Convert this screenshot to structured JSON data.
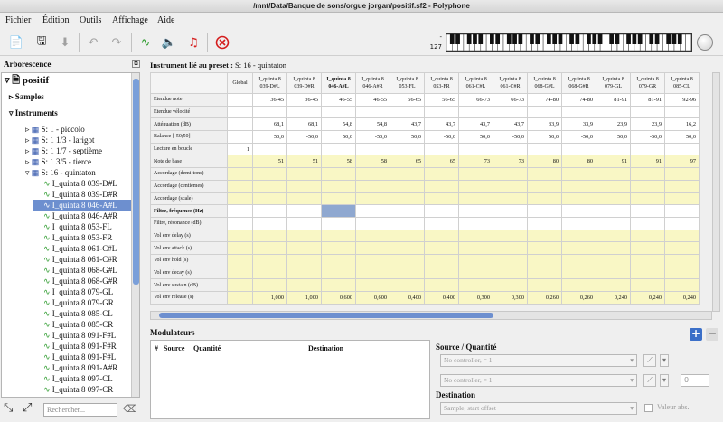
{
  "window": {
    "title": "/mnt/Data/Banque de sons/orgue jorgan/positif.sf2 - Polyphone"
  },
  "menu": [
    "Fichier",
    "Édition",
    "Outils",
    "Affichage",
    "Aide"
  ],
  "toolbar": {
    "volume_top": "-",
    "volume_bottom": "127"
  },
  "left": {
    "title": "Arborescence",
    "root": "positif",
    "samples": "Samples",
    "instruments": "Instruments",
    "items": [
      "S: 1 - piccolo",
      "S: 1 1/3 - larigot",
      "S: 1 1/7 - septième",
      "S: 1 3/5 - tierce",
      "S: 16 - quintaton"
    ],
    "children": [
      "I_quinta 8 039-D#L",
      "I_quinta 8 039-D#R",
      "I_quinta 8 046-A#L",
      "I_quinta 8 046-A#R",
      "I_quinta 8 053-FL",
      "I_quinta 8 053-FR",
      "I_quinta 8 061-C#L",
      "I_quinta 8 061-C#R",
      "I_quinta 8 068-G#L",
      "I_quinta 8 068-G#R",
      "I_quinta 8 079-GL",
      "I_quinta 8 079-GR",
      "I_quinta 8 085-CL",
      "I_quinta 8 085-CR",
      "I_quinta 8 091-F#L",
      "I_quinta 8 091-F#R",
      "I_quinta 8 091-F#L",
      "I_quinta 8 091-A#R",
      "I_quinta 8 097-CL",
      "I_quinta 8 097-CR",
      "I_quinta 8 097-CR"
    ],
    "search_placeholder": "Rechercher..."
  },
  "editor": {
    "title_label": "Instrument lié au preset :",
    "title_value": "S: 16 - quintaton",
    "columns": [
      "Global",
      "I_quinta 8\n039-D#L",
      "I_quinta 8\n039-D#R",
      "I_quinta 8\n046-A#L",
      "I_quinta 8\n046-A#R",
      "I_quinta 8\n053-FL",
      "I_quinta 8\n053-FR",
      "I_quinta 8\n061-C#L",
      "I_quinta 8\n061-C#R",
      "I_quinta 8\n068-G#L",
      "I_quinta 8\n068-G#R",
      "I_quinta 8\n079-GL",
      "I_quinta 8\n079-GR",
      "I_quinta 8\n085-CL"
    ],
    "rows": [
      {
        "label": "Etendue note",
        "values": [
          "",
          "36-45",
          "36-45",
          "46-55",
          "46-55",
          "56-65",
          "56-65",
          "66-73",
          "66-73",
          "74-80",
          "74-80",
          "81-91",
          "81-91",
          "92-96"
        ]
      },
      {
        "label": "Etendue vélocité",
        "values": [
          "",
          "",
          "",
          "",
          "",
          "",
          "",
          "",
          "",
          "",
          "",
          "",
          "",
          ""
        ]
      },
      {
        "label": "Atténuation (dB)",
        "values": [
          "",
          "68,1",
          "68,1",
          "54,8",
          "54,8",
          "43,7",
          "43,7",
          "43,7",
          "43,7",
          "33,9",
          "33,9",
          "23,9",
          "23,9",
          "16,2"
        ]
      },
      {
        "label": "Balance [-50;50]",
        "values": [
          "",
          "50,0",
          "-50,0",
          "50,0",
          "-50,0",
          "50,0",
          "-50,0",
          "50,0",
          "-50,0",
          "50,0",
          "-50,0",
          "50,0",
          "-50,0",
          "50,0"
        ]
      },
      {
        "label": "Lecture en boucle",
        "values": [
          "1",
          "",
          "",
          "",
          "",
          "",
          "",
          "",
          "",
          "",
          "",
          "",
          "",
          ""
        ]
      },
      {
        "label": "Note de base",
        "values": [
          "",
          "51",
          "51",
          "58",
          "58",
          "65",
          "65",
          "73",
          "73",
          "80",
          "80",
          "91",
          "91",
          "97"
        ]
      },
      {
        "label": "Accordage (demi-tons)",
        "values": [
          "",
          "",
          "",
          "",
          "",
          "",
          "",
          "",
          "",
          "",
          "",
          "",
          "",
          ""
        ]
      },
      {
        "label": "Accordage (centièmes)",
        "values": [
          "",
          "",
          "",
          "",
          "",
          "",
          "",
          "",
          "",
          "",
          "",
          "",
          "",
          ""
        ]
      },
      {
        "label": "Accordage (scale)",
        "values": [
          "",
          "",
          "",
          "",
          "",
          "",
          "",
          "",
          "",
          "",
          "",
          "",
          "",
          ""
        ]
      },
      {
        "label": "Filtre, fréquence (Hz)",
        "values": [
          "",
          "",
          "",
          "",
          "",
          "",
          "",
          "",
          "",
          "",
          "",
          "",
          "",
          ""
        ]
      },
      {
        "label": "Filtre, résonance (dB)",
        "values": [
          "",
          "",
          "",
          "",
          "",
          "",
          "",
          "",
          "",
          "",
          "",
          "",
          "",
          ""
        ]
      },
      {
        "label": "Vol env delay (s)",
        "values": [
          "",
          "",
          "",
          "",
          "",
          "",
          "",
          "",
          "",
          "",
          "",
          "",
          "",
          ""
        ]
      },
      {
        "label": "Vol env attack (s)",
        "values": [
          "",
          "",
          "",
          "",
          "",
          "",
          "",
          "",
          "",
          "",
          "",
          "",
          "",
          ""
        ]
      },
      {
        "label": "Vol env hold (s)",
        "values": [
          "",
          "",
          "",
          "",
          "",
          "",
          "",
          "",
          "",
          "",
          "",
          "",
          "",
          ""
        ]
      },
      {
        "label": "Vol env decay (s)",
        "values": [
          "",
          "",
          "",
          "",
          "",
          "",
          "",
          "",
          "",
          "",
          "",
          "",
          "",
          ""
        ]
      },
      {
        "label": "Vol env sustain (dB)",
        "values": [
          "",
          "",
          "",
          "",
          "",
          "",
          "",
          "",
          "",
          "",
          "",
          "",
          "",
          ""
        ]
      },
      {
        "label": "Vol env release (s)",
        "values": [
          "",
          "1,000",
          "1,000",
          "0,600",
          "0,600",
          "0,400",
          "0,400",
          "0,300",
          "0,300",
          "0,260",
          "0,260",
          "0,240",
          "0,240",
          "0,240"
        ]
      }
    ]
  },
  "modulators": {
    "title": "Modulateurs",
    "headers": [
      "#",
      "Source",
      "Quantité",
      "Destination"
    ],
    "source_title": "Source / Quantité",
    "source1": "No controller, = 1",
    "source2": "No controller, = 1",
    "spin": "0",
    "dest_title": "Destination",
    "dest": "Sample, start offset",
    "abs_label": "Valeur abs."
  }
}
